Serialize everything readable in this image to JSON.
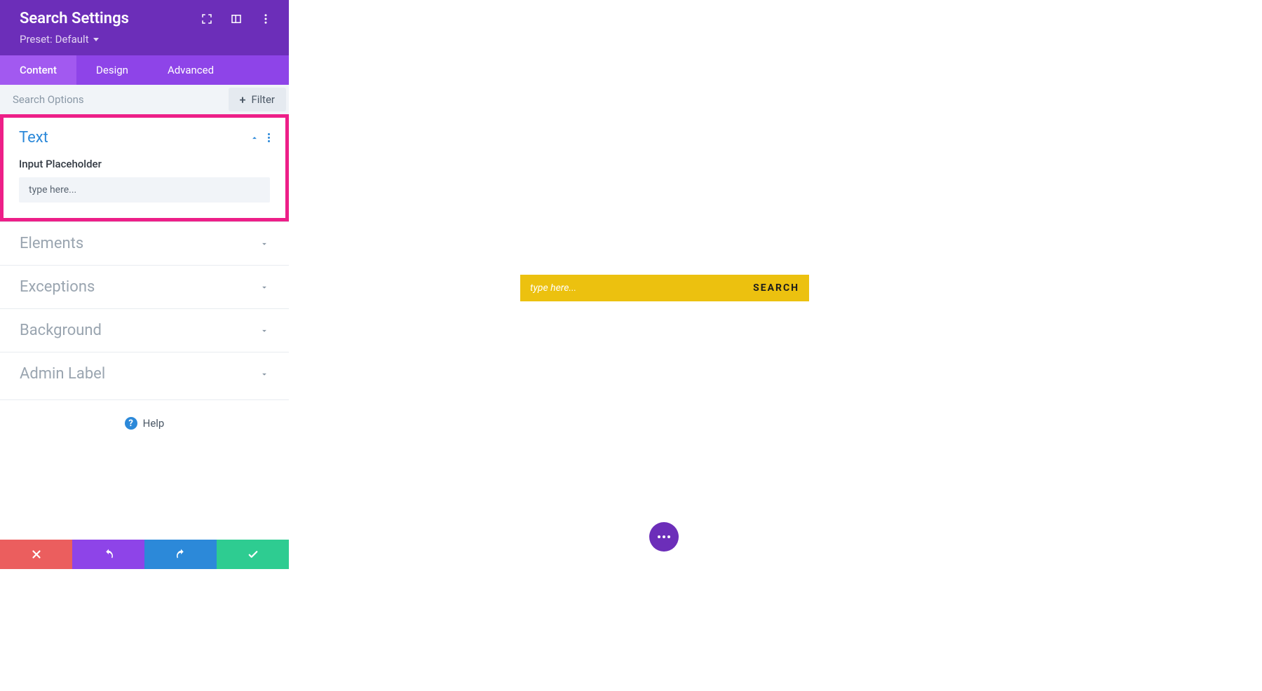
{
  "header": {
    "title": "Search Settings",
    "preset_label": "Preset:",
    "preset_value": "Default"
  },
  "tabs": {
    "content": "Content",
    "design": "Design",
    "advanced": "Advanced"
  },
  "search_row": {
    "placeholder": "Search Options",
    "filter_label": "Filter"
  },
  "sections": {
    "text": {
      "title": "Text",
      "field_label": "Input Placeholder",
      "field_value": "type here..."
    },
    "elements": {
      "title": "Elements"
    },
    "exceptions": {
      "title": "Exceptions"
    },
    "background": {
      "title": "Background"
    },
    "admin_label": {
      "title": "Admin Label"
    }
  },
  "help": {
    "label": "Help"
  },
  "preview": {
    "placeholder": "type here...",
    "button": "SEARCH"
  }
}
